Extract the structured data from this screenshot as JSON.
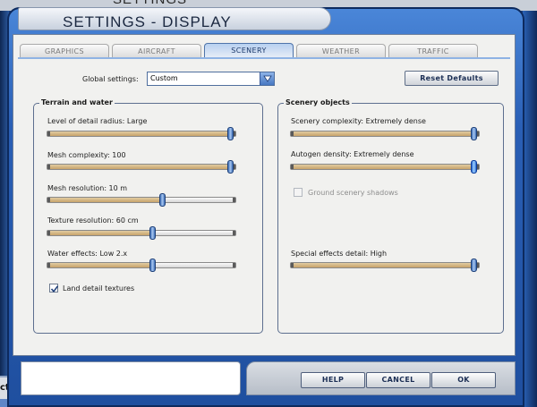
{
  "background": {
    "top_text": "SETTINGS",
    "left_fragment": "cts"
  },
  "window": {
    "title": "SETTINGS - DISPLAY"
  },
  "tabs": [
    {
      "label": "GRAPHICS",
      "active": false
    },
    {
      "label": "AIRCRAFT",
      "active": false
    },
    {
      "label": "SCENERY",
      "active": true
    },
    {
      "label": "WEATHER",
      "active": false
    },
    {
      "label": "TRAFFIC",
      "active": false
    }
  ],
  "global": {
    "label": "Global settings:",
    "value": "Custom"
  },
  "reset_label": "Reset Defaults",
  "terrain": {
    "title": "Terrain and water",
    "sliders": [
      {
        "label": "Level of detail radius: Large",
        "level": 1.0
      },
      {
        "label": "Mesh complexity: 100",
        "level": 1.0
      },
      {
        "label": "Mesh resolution: 10 m",
        "level": 0.62
      },
      {
        "label": "Texture resolution: 60 cm",
        "level": 0.57
      },
      {
        "label": "Water effects: Low 2.x",
        "level": 0.57
      }
    ],
    "checkbox": {
      "label": "Land detail textures",
      "checked": true
    }
  },
  "scenery": {
    "title": "Scenery objects",
    "sliders": [
      {
        "label": "Scenery complexity: Extremely dense",
        "level": 1.0
      },
      {
        "label": "Autogen density: Extremely dense",
        "level": 1.0
      }
    ],
    "checkbox": {
      "label": "Ground scenery shadows",
      "checked": false,
      "enabled": false
    },
    "special": {
      "label": "Special effects detail: High",
      "level": 1.0
    }
  },
  "buttons": {
    "help": "HELP",
    "cancel": "CANCEL",
    "ok": "OK"
  },
  "colors": {
    "fill": "#c7a36a",
    "thumb": "#3e6fb8",
    "accent": "#2a5fb5"
  }
}
